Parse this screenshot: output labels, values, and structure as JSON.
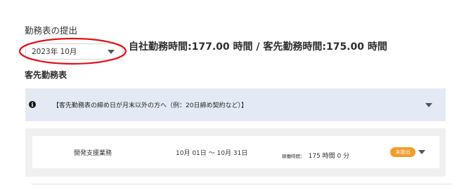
{
  "page": {
    "title": "勤務表の提出"
  },
  "month_select": {
    "value": "2023年 10月"
  },
  "summary": {
    "hours_text": "自社勤務時間:177.00 時間 / 客先勤務時間:175.00 時間"
  },
  "section": {
    "title": "客先勤務表"
  },
  "notice": {
    "text": "【客先勤務表の締め日が月末以外の方へ（例：20日締め契約など）】"
  },
  "timesheet_row": {
    "work_name": "開発支援業務",
    "period": "10月 01日 〜 10月 31日",
    "worked_label": "稼働時間：",
    "worked_value": "175 時間 0 分",
    "status": "未提出"
  },
  "colors": {
    "notice_bg": "#e4eaf5",
    "status_badge": "#f39c2b",
    "highlight": "#e0101a"
  }
}
